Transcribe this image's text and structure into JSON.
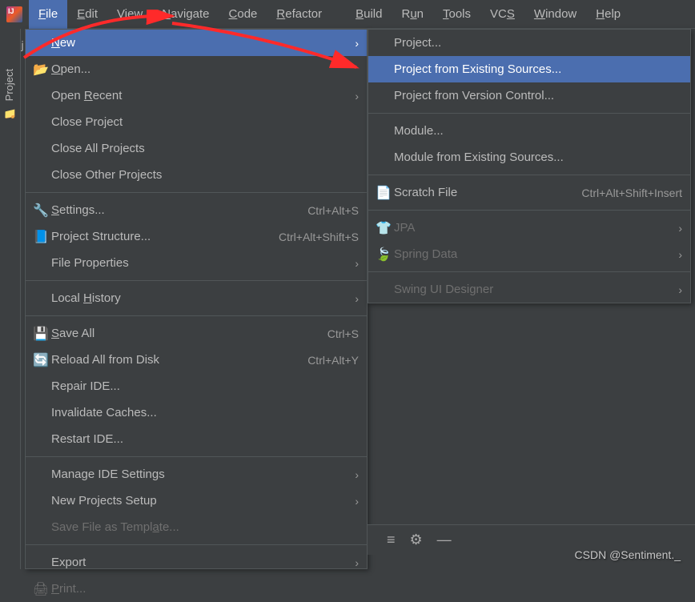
{
  "menubar": {
    "items": [
      {
        "label": "File",
        "u": "F",
        "rest": "ile",
        "active": true
      },
      {
        "label": "Edit",
        "u": "E",
        "rest": "dit"
      },
      {
        "label": "View",
        "u": "V",
        "rest": "iew"
      },
      {
        "label": "Navigate",
        "u": "N",
        "rest": "avigate"
      },
      {
        "label": "Code",
        "u": "C",
        "rest": "ode"
      },
      {
        "label": "Refactor",
        "u": "R",
        "rest": "efactor"
      },
      {
        "label": "Build",
        "u": "B",
        "rest": "uild"
      },
      {
        "label": "Run",
        "u": "R",
        "pre": "R",
        "urest": "u",
        "rest": "n"
      },
      {
        "label": "Tools",
        "u": "T",
        "rest": "ools"
      },
      {
        "label": "VCS",
        "u": "S",
        "pre": "VC"
      },
      {
        "label": "Window",
        "u": "W",
        "rest": "indow"
      },
      {
        "label": "Help",
        "u": "H",
        "rest": "elp"
      }
    ]
  },
  "sidebar": {
    "tab": "Project"
  },
  "tab": {
    "name": "rt.j"
  },
  "fileMenu": {
    "items": [
      {
        "icon": "",
        "label": "New",
        "u": "N",
        "rest": "ew",
        "sub": "›",
        "highlighted": true
      },
      {
        "icon": "📂",
        "label": "Open...",
        "u": "O",
        "rest": "pen..."
      },
      {
        "icon": "",
        "label": "Open Recent",
        "pre": "Open ",
        "u": "R",
        "rest": "ecent",
        "sub": "›"
      },
      {
        "icon": "",
        "label": "Close Project"
      },
      {
        "icon": "",
        "label": "Close All Projects"
      },
      {
        "icon": "",
        "label": "Close Other Projects"
      },
      {
        "sep": true
      },
      {
        "icon": "🔧",
        "label": "Settings...",
        "u": "S",
        "rest": "ettings...",
        "shortcut": "Ctrl+Alt+S"
      },
      {
        "icon": "📘",
        "label": "Project Structure...",
        "shortcut": "Ctrl+Alt+Shift+S"
      },
      {
        "icon": "",
        "label": "File Properties",
        "sub": "›"
      },
      {
        "sep": true
      },
      {
        "icon": "",
        "label": "Local History",
        "pre": "Local ",
        "u": "H",
        "rest": "istory",
        "sub": "›"
      },
      {
        "sep": true
      },
      {
        "icon": "💾",
        "label": "Save All",
        "u": "S",
        "rest": "ave All",
        "shortcut": "Ctrl+S"
      },
      {
        "icon": "🔄",
        "label": "Reload All from Disk",
        "shortcut": "Ctrl+Alt+Y"
      },
      {
        "icon": "",
        "label": "Repair IDE..."
      },
      {
        "icon": "",
        "label": "Invalidate Caches..."
      },
      {
        "icon": "",
        "label": "Restart IDE..."
      },
      {
        "sep": true
      },
      {
        "icon": "",
        "label": "Manage IDE Settings",
        "sub": "›"
      },
      {
        "icon": "",
        "label": "New Projects Setup",
        "sub": "›"
      },
      {
        "icon": "",
        "label": "Save File as Template...",
        "pre": "Save File as Templ",
        "u": "a",
        "rest": "te...",
        "disabled": true
      },
      {
        "sep": true
      },
      {
        "icon": "",
        "label": "Export",
        "sub": "›"
      },
      {
        "icon": "🖨",
        "label": "Print...",
        "u": "P",
        "rest": "rint...",
        "disabled": true
      }
    ]
  },
  "newMenu": {
    "items": [
      {
        "icon": "",
        "label": "Project..."
      },
      {
        "icon": "",
        "label": "Project from Existing Sources...",
        "highlighted": true
      },
      {
        "icon": "",
        "label": "Project from Version Control..."
      },
      {
        "sep": true
      },
      {
        "icon": "",
        "label": "Module..."
      },
      {
        "icon": "",
        "label": "Module from Existing Sources..."
      },
      {
        "sep": true
      },
      {
        "icon": "📄",
        "label": "Scratch File",
        "shortcut": "Ctrl+Alt+Shift+Insert"
      },
      {
        "sep": true
      },
      {
        "icon": "👕",
        "label": "JPA",
        "disabled": true,
        "sub": "›"
      },
      {
        "icon": "🍃",
        "label": "Spring Data",
        "disabled": true,
        "sub": "›"
      },
      {
        "sep": true
      },
      {
        "icon": "",
        "label": "Swing UI Designer",
        "disabled": true,
        "sub": "›"
      }
    ]
  },
  "watermark": "CSDN @Sentiment._",
  "toolbar": {
    "icons": [
      "≡",
      "⚙",
      "—"
    ]
  }
}
